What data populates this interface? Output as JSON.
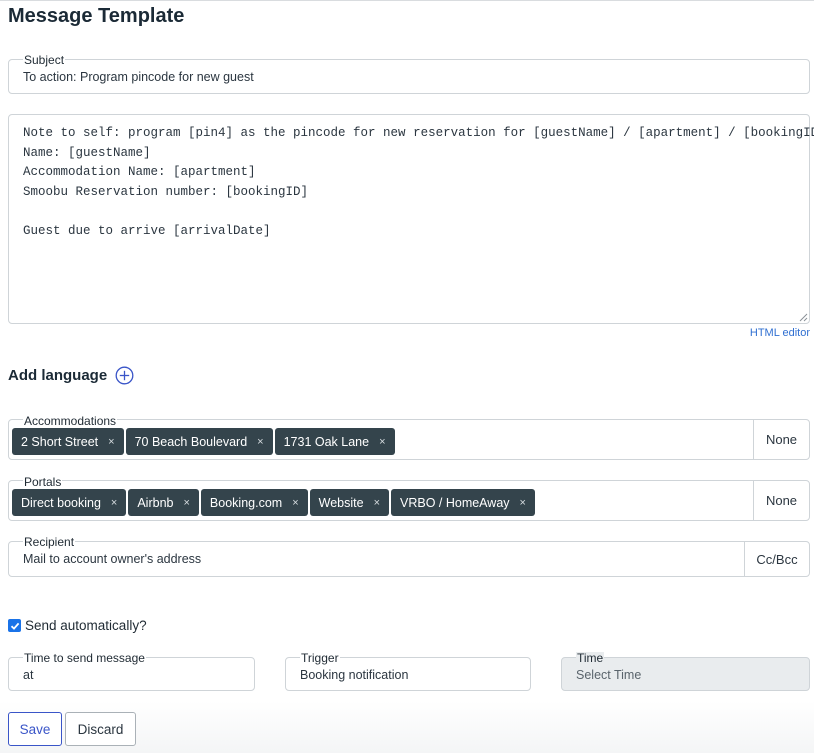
{
  "page": {
    "title": "Message Template"
  },
  "subject": {
    "label": "Subject",
    "value": "To action: Program pincode for new guest"
  },
  "message": {
    "body": "Note to self: program [pin4] as the pincode for new reservation for [guestName] / [apartment] / [bookingID]\nName: [guestName]\nAccommodation Name: [apartment]\nSmoobu Reservation number: [bookingID]\n\nGuest due to arrive [arrivalDate]",
    "html_editor_label": "HTML editor"
  },
  "add_language": {
    "label": "Add language",
    "icon": "plus-circle-icon"
  },
  "accommodations": {
    "label": "Accommodations",
    "tags": [
      "2 Short Street",
      "70 Beach Boulevard",
      "1731 Oak Lane"
    ],
    "remove_glyph": "×",
    "none_label": "None"
  },
  "portals": {
    "label": "Portals",
    "tags": [
      "Direct booking",
      "Airbnb",
      "Booking.com",
      "Website",
      "VRBO / HomeAway"
    ],
    "remove_glyph": "×",
    "none_label": "None"
  },
  "recipient": {
    "label": "Recipient",
    "value": "Mail to account owner's address",
    "ccbcc_label": "Cc/Bcc"
  },
  "send_automatically": {
    "label": "Send automatically?",
    "checked": true
  },
  "time_to_send": {
    "label": "Time to send message",
    "value": "at"
  },
  "trigger": {
    "label": "Trigger",
    "value": "Booking notification"
  },
  "time": {
    "label": "Time",
    "placeholder": "Select Time"
  },
  "actions": {
    "save_label": "Save",
    "discard_label": "Discard"
  },
  "colors": {
    "tag_bg": "#34444c",
    "accent_blue": "#1a73e8",
    "save_blue": "#3a55c8",
    "link_blue": "#2f6fd1"
  }
}
